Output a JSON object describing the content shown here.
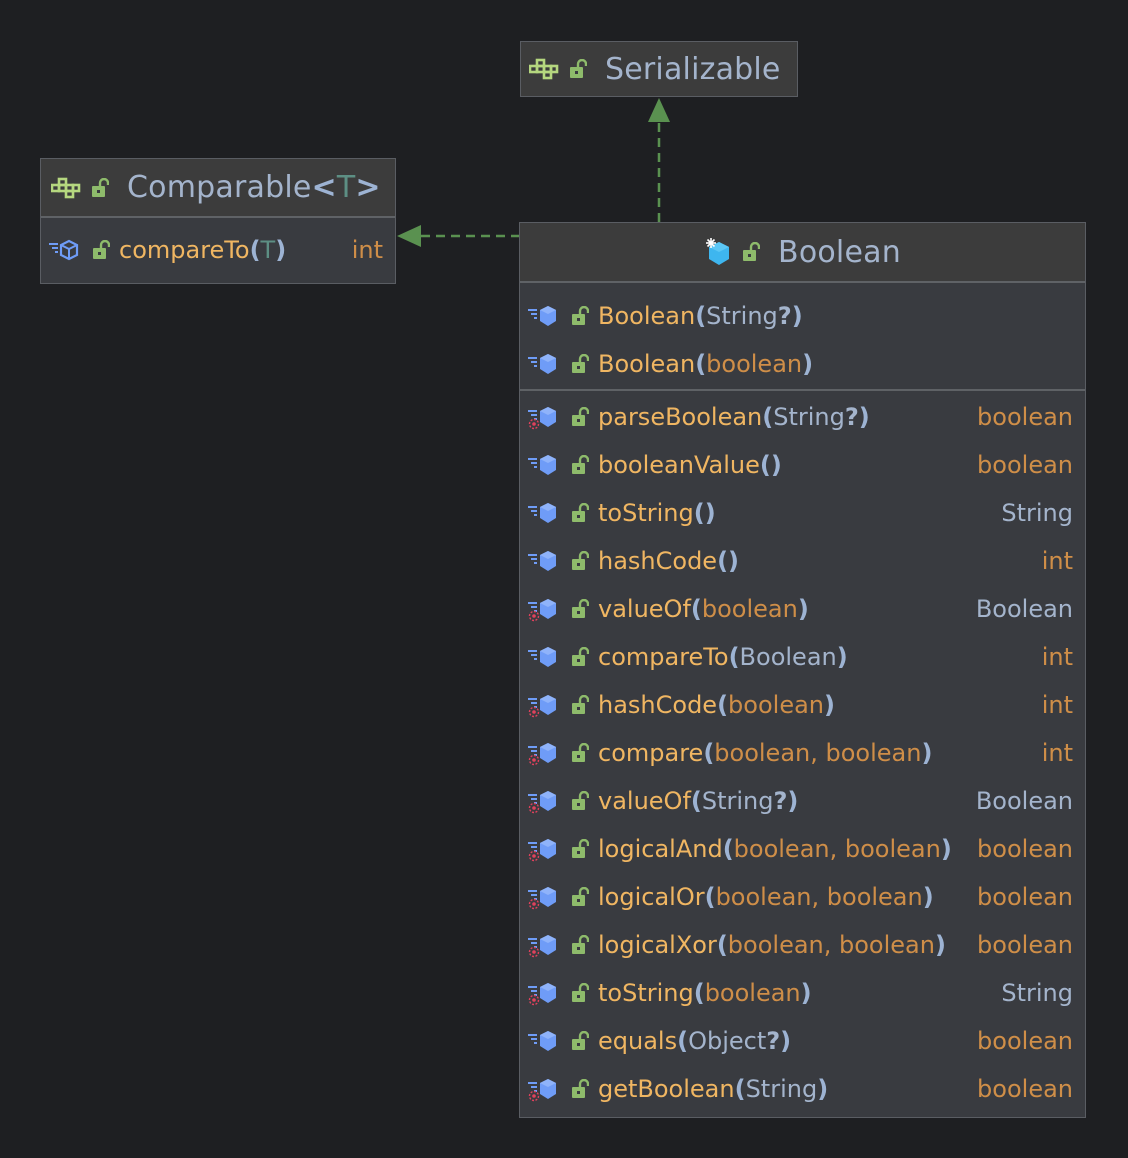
{
  "diagram": {
    "type": "uml-class-diagram",
    "colors": {
      "background": "#1e1f22",
      "node_fill": "#393b40",
      "header_fill": "#3c3c3c",
      "border": "#5a5d63",
      "method_name": "#f0b662",
      "primitive_type": "#cf8e48",
      "reference_type": "#a4b4cc",
      "type_parameter": "#5d8f84",
      "edge": "#5a9150",
      "interface_icon": "#b5d77f",
      "public_lock": "#8ebb6b",
      "method_icon": "#6f9cf7",
      "class_icon": "#3eb6ef",
      "static_marker": "#e0415c"
    },
    "nodes": {
      "serializable": {
        "kind": "interface",
        "name": "Serializable",
        "type_params": null
      },
      "comparable": {
        "kind": "interface",
        "name": "Comparable",
        "type_open": "<",
        "type_param": "T",
        "type_close": ">",
        "methods": [
          {
            "name": "compareTo",
            "open": "(",
            "params": [
              {
                "text": "T",
                "kind": "tparam"
              }
            ],
            "close": ")",
            "returns": "int",
            "return_kind": "prim",
            "static": false
          }
        ]
      },
      "boolean": {
        "kind": "final-class",
        "name": "Boolean",
        "constructors": [
          {
            "name": "Boolean",
            "open": "(",
            "params": [
              {
                "text": "String",
                "kind": "ref"
              },
              {
                "text": "?",
                "kind": "q"
              }
            ],
            "close": ")"
          },
          {
            "name": "Boolean",
            "open": "(",
            "params": [
              {
                "text": "boolean",
                "kind": "prim"
              }
            ],
            "close": ")"
          }
        ],
        "methods": [
          {
            "name": "parseBoolean",
            "open": "(",
            "params": [
              {
                "text": "String",
                "kind": "ref"
              },
              {
                "text": "?",
                "kind": "q"
              }
            ],
            "close": ")",
            "returns": "boolean",
            "return_kind": "prim",
            "static": true
          },
          {
            "name": "booleanValue",
            "open": "(",
            "params": [],
            "close": ")",
            "returns": "boolean",
            "return_kind": "prim",
            "static": false
          },
          {
            "name": "toString",
            "open": "(",
            "params": [],
            "close": ")",
            "returns": "String",
            "return_kind": "ref",
            "static": false
          },
          {
            "name": "hashCode",
            "open": "(",
            "params": [],
            "close": ")",
            "returns": "int",
            "return_kind": "prim",
            "static": false
          },
          {
            "name": "valueOf",
            "open": "(",
            "params": [
              {
                "text": "boolean",
                "kind": "prim"
              }
            ],
            "close": ")",
            "returns": "Boolean",
            "return_kind": "ref",
            "static": true
          },
          {
            "name": "compareTo",
            "open": "(",
            "params": [
              {
                "text": "Boolean",
                "kind": "ref"
              }
            ],
            "close": ")",
            "returns": "int",
            "return_kind": "prim",
            "static": false
          },
          {
            "name": "hashCode",
            "open": "(",
            "params": [
              {
                "text": "boolean",
                "kind": "prim"
              }
            ],
            "close": ")",
            "returns": "int",
            "return_kind": "prim",
            "static": true
          },
          {
            "name": "compare",
            "open": "(",
            "params": [
              {
                "text": "boolean, boolean",
                "kind": "prim"
              }
            ],
            "close": ")",
            "returns": "int",
            "return_kind": "prim",
            "static": true
          },
          {
            "name": "valueOf",
            "open": "(",
            "params": [
              {
                "text": "String",
                "kind": "ref"
              },
              {
                "text": "?",
                "kind": "q"
              }
            ],
            "close": ")",
            "returns": "Boolean",
            "return_kind": "ref",
            "static": true
          },
          {
            "name": "logicalAnd",
            "open": "(",
            "params": [
              {
                "text": "boolean, boolean",
                "kind": "prim"
              }
            ],
            "close": ")",
            "returns": "boolean",
            "return_kind": "prim",
            "static": true
          },
          {
            "name": "logicalOr",
            "open": "(",
            "params": [
              {
                "text": "boolean, boolean",
                "kind": "prim"
              }
            ],
            "close": ")",
            "returns": "boolean",
            "return_kind": "prim",
            "static": true
          },
          {
            "name": "logicalXor",
            "open": "(",
            "params": [
              {
                "text": "boolean, boolean",
                "kind": "prim"
              }
            ],
            "close": ")",
            "returns": "boolean",
            "return_kind": "prim",
            "static": true
          },
          {
            "name": "toString",
            "open": "(",
            "params": [
              {
                "text": "boolean",
                "kind": "prim"
              }
            ],
            "close": ")",
            "returns": "String",
            "return_kind": "ref",
            "static": true
          },
          {
            "name": "equals",
            "open": "(",
            "params": [
              {
                "text": "Object",
                "kind": "ref"
              },
              {
                "text": "?",
                "kind": "q"
              }
            ],
            "close": ")",
            "returns": "boolean",
            "return_kind": "prim",
            "static": false
          },
          {
            "name": "getBoolean",
            "open": "(",
            "params": [
              {
                "text": "String",
                "kind": "ref"
              }
            ],
            "close": ")",
            "returns": "boolean",
            "return_kind": "prim",
            "static": true
          }
        ]
      }
    },
    "edges": [
      {
        "from": "boolean",
        "to": "serializable",
        "relation": "implements",
        "style": "dashed"
      },
      {
        "from": "boolean",
        "to": "comparable",
        "relation": "implements",
        "style": "dashed"
      }
    ]
  }
}
